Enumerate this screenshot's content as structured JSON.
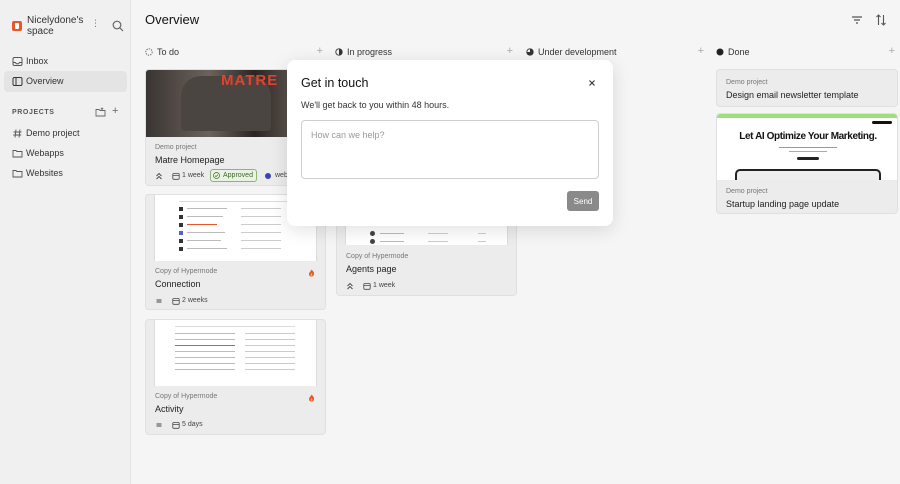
{
  "workspace": {
    "name": "Nicelydone's space",
    "more_glyph": "⋮"
  },
  "nav": [
    {
      "label": "Inbox",
      "icon": "inbox-icon"
    },
    {
      "label": "Overview",
      "icon": "sidebar-panel-icon",
      "active": true
    }
  ],
  "projects": {
    "section_label": "PROJECTS",
    "add_glyph": "+",
    "items": [
      {
        "label": "Demo project",
        "icon": "hash-icon"
      },
      {
        "label": "Webapps",
        "icon": "folder-icon"
      },
      {
        "label": "Websites",
        "icon": "folder-icon"
      }
    ]
  },
  "header": {
    "title": "Overview"
  },
  "columns": [
    {
      "label": "To do",
      "status": "todo",
      "add_glyph": "+"
    },
    {
      "label": "In progress",
      "status": "in-progress",
      "add_glyph": "+"
    },
    {
      "label": "Under development",
      "status": "under-development",
      "add_glyph": "+"
    },
    {
      "label": "Done",
      "status": "done",
      "add_glyph": "+"
    }
  ],
  "cards": {
    "todo_1": {
      "project": "Demo project",
      "title": "Matre Homepage",
      "duration": "1 week",
      "badge": "Approved",
      "tag": "web",
      "thumb_text": "MATRE"
    },
    "todo_2": {
      "project": "Copy of Hypermode",
      "title": "Connection",
      "duration": "2 weeks"
    },
    "todo_3": {
      "project": "Copy of Hypermode",
      "title": "Activity",
      "duration": "5 days"
    },
    "inprog_1": {
      "project": "Copy of Hypermode",
      "title": "Agents page",
      "duration": "1 week"
    },
    "done_1": {
      "project": "Demo project",
      "title": "Design email newsletter template"
    },
    "done_2": {
      "project": "Demo project",
      "title": "Startup landing page update",
      "thumb_text": "Let AI Optimize Your Marketing."
    }
  },
  "modal": {
    "title": "Get in touch",
    "subtitle": "We'll get back to you within 48 hours.",
    "placeholder": "How can we help?",
    "send_label": "Send"
  },
  "colors": {
    "accent": "#e8572a",
    "approved": "#3d6a2a",
    "tag_dot": "#3b43b8",
    "send_button": "#8a8a8a"
  }
}
